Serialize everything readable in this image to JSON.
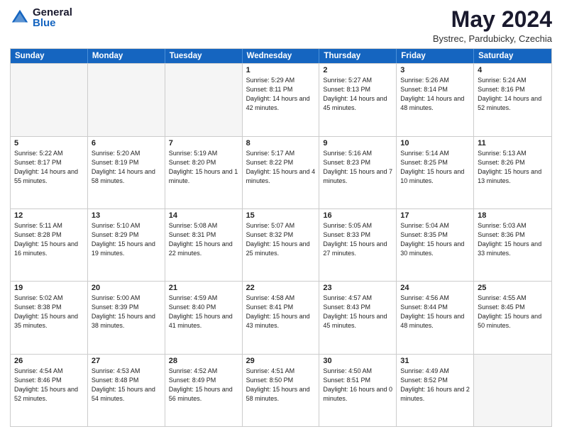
{
  "logo": {
    "general": "General",
    "blue": "Blue"
  },
  "header": {
    "month": "May 2024",
    "location": "Bystrec, Pardubicky, Czechia"
  },
  "weekdays": [
    "Sunday",
    "Monday",
    "Tuesday",
    "Wednesday",
    "Thursday",
    "Friday",
    "Saturday"
  ],
  "weeks": [
    [
      {
        "day": "",
        "empty": true,
        "sunrise": "",
        "sunset": "",
        "daylight": ""
      },
      {
        "day": "",
        "empty": true,
        "sunrise": "",
        "sunset": "",
        "daylight": ""
      },
      {
        "day": "",
        "empty": true,
        "sunrise": "",
        "sunset": "",
        "daylight": ""
      },
      {
        "day": "1",
        "empty": false,
        "sunrise": "Sunrise: 5:29 AM",
        "sunset": "Sunset: 8:11 PM",
        "daylight": "Daylight: 14 hours and 42 minutes."
      },
      {
        "day": "2",
        "empty": false,
        "sunrise": "Sunrise: 5:27 AM",
        "sunset": "Sunset: 8:13 PM",
        "daylight": "Daylight: 14 hours and 45 minutes."
      },
      {
        "day": "3",
        "empty": false,
        "sunrise": "Sunrise: 5:26 AM",
        "sunset": "Sunset: 8:14 PM",
        "daylight": "Daylight: 14 hours and 48 minutes."
      },
      {
        "day": "4",
        "empty": false,
        "sunrise": "Sunrise: 5:24 AM",
        "sunset": "Sunset: 8:16 PM",
        "daylight": "Daylight: 14 hours and 52 minutes."
      }
    ],
    [
      {
        "day": "5",
        "empty": false,
        "sunrise": "Sunrise: 5:22 AM",
        "sunset": "Sunset: 8:17 PM",
        "daylight": "Daylight: 14 hours and 55 minutes."
      },
      {
        "day": "6",
        "empty": false,
        "sunrise": "Sunrise: 5:20 AM",
        "sunset": "Sunset: 8:19 PM",
        "daylight": "Daylight: 14 hours and 58 minutes."
      },
      {
        "day": "7",
        "empty": false,
        "sunrise": "Sunrise: 5:19 AM",
        "sunset": "Sunset: 8:20 PM",
        "daylight": "Daylight: 15 hours and 1 minute."
      },
      {
        "day": "8",
        "empty": false,
        "sunrise": "Sunrise: 5:17 AM",
        "sunset": "Sunset: 8:22 PM",
        "daylight": "Daylight: 15 hours and 4 minutes."
      },
      {
        "day": "9",
        "empty": false,
        "sunrise": "Sunrise: 5:16 AM",
        "sunset": "Sunset: 8:23 PM",
        "daylight": "Daylight: 15 hours and 7 minutes."
      },
      {
        "day": "10",
        "empty": false,
        "sunrise": "Sunrise: 5:14 AM",
        "sunset": "Sunset: 8:25 PM",
        "daylight": "Daylight: 15 hours and 10 minutes."
      },
      {
        "day": "11",
        "empty": false,
        "sunrise": "Sunrise: 5:13 AM",
        "sunset": "Sunset: 8:26 PM",
        "daylight": "Daylight: 15 hours and 13 minutes."
      }
    ],
    [
      {
        "day": "12",
        "empty": false,
        "sunrise": "Sunrise: 5:11 AM",
        "sunset": "Sunset: 8:28 PM",
        "daylight": "Daylight: 15 hours and 16 minutes."
      },
      {
        "day": "13",
        "empty": false,
        "sunrise": "Sunrise: 5:10 AM",
        "sunset": "Sunset: 8:29 PM",
        "daylight": "Daylight: 15 hours and 19 minutes."
      },
      {
        "day": "14",
        "empty": false,
        "sunrise": "Sunrise: 5:08 AM",
        "sunset": "Sunset: 8:31 PM",
        "daylight": "Daylight: 15 hours and 22 minutes."
      },
      {
        "day": "15",
        "empty": false,
        "sunrise": "Sunrise: 5:07 AM",
        "sunset": "Sunset: 8:32 PM",
        "daylight": "Daylight: 15 hours and 25 minutes."
      },
      {
        "day": "16",
        "empty": false,
        "sunrise": "Sunrise: 5:05 AM",
        "sunset": "Sunset: 8:33 PM",
        "daylight": "Daylight: 15 hours and 27 minutes."
      },
      {
        "day": "17",
        "empty": false,
        "sunrise": "Sunrise: 5:04 AM",
        "sunset": "Sunset: 8:35 PM",
        "daylight": "Daylight: 15 hours and 30 minutes."
      },
      {
        "day": "18",
        "empty": false,
        "sunrise": "Sunrise: 5:03 AM",
        "sunset": "Sunset: 8:36 PM",
        "daylight": "Daylight: 15 hours and 33 minutes."
      }
    ],
    [
      {
        "day": "19",
        "empty": false,
        "sunrise": "Sunrise: 5:02 AM",
        "sunset": "Sunset: 8:38 PM",
        "daylight": "Daylight: 15 hours and 35 minutes."
      },
      {
        "day": "20",
        "empty": false,
        "sunrise": "Sunrise: 5:00 AM",
        "sunset": "Sunset: 8:39 PM",
        "daylight": "Daylight: 15 hours and 38 minutes."
      },
      {
        "day": "21",
        "empty": false,
        "sunrise": "Sunrise: 4:59 AM",
        "sunset": "Sunset: 8:40 PM",
        "daylight": "Daylight: 15 hours and 41 minutes."
      },
      {
        "day": "22",
        "empty": false,
        "sunrise": "Sunrise: 4:58 AM",
        "sunset": "Sunset: 8:41 PM",
        "daylight": "Daylight: 15 hours and 43 minutes."
      },
      {
        "day": "23",
        "empty": false,
        "sunrise": "Sunrise: 4:57 AM",
        "sunset": "Sunset: 8:43 PM",
        "daylight": "Daylight: 15 hours and 45 minutes."
      },
      {
        "day": "24",
        "empty": false,
        "sunrise": "Sunrise: 4:56 AM",
        "sunset": "Sunset: 8:44 PM",
        "daylight": "Daylight: 15 hours and 48 minutes."
      },
      {
        "day": "25",
        "empty": false,
        "sunrise": "Sunrise: 4:55 AM",
        "sunset": "Sunset: 8:45 PM",
        "daylight": "Daylight: 15 hours and 50 minutes."
      }
    ],
    [
      {
        "day": "26",
        "empty": false,
        "sunrise": "Sunrise: 4:54 AM",
        "sunset": "Sunset: 8:46 PM",
        "daylight": "Daylight: 15 hours and 52 minutes."
      },
      {
        "day": "27",
        "empty": false,
        "sunrise": "Sunrise: 4:53 AM",
        "sunset": "Sunset: 8:48 PM",
        "daylight": "Daylight: 15 hours and 54 minutes."
      },
      {
        "day": "28",
        "empty": false,
        "sunrise": "Sunrise: 4:52 AM",
        "sunset": "Sunset: 8:49 PM",
        "daylight": "Daylight: 15 hours and 56 minutes."
      },
      {
        "day": "29",
        "empty": false,
        "sunrise": "Sunrise: 4:51 AM",
        "sunset": "Sunset: 8:50 PM",
        "daylight": "Daylight: 15 hours and 58 minutes."
      },
      {
        "day": "30",
        "empty": false,
        "sunrise": "Sunrise: 4:50 AM",
        "sunset": "Sunset: 8:51 PM",
        "daylight": "Daylight: 16 hours and 0 minutes."
      },
      {
        "day": "31",
        "empty": false,
        "sunrise": "Sunrise: 4:49 AM",
        "sunset": "Sunset: 8:52 PM",
        "daylight": "Daylight: 16 hours and 2 minutes."
      },
      {
        "day": "",
        "empty": true,
        "sunrise": "",
        "sunset": "",
        "daylight": ""
      }
    ]
  ]
}
